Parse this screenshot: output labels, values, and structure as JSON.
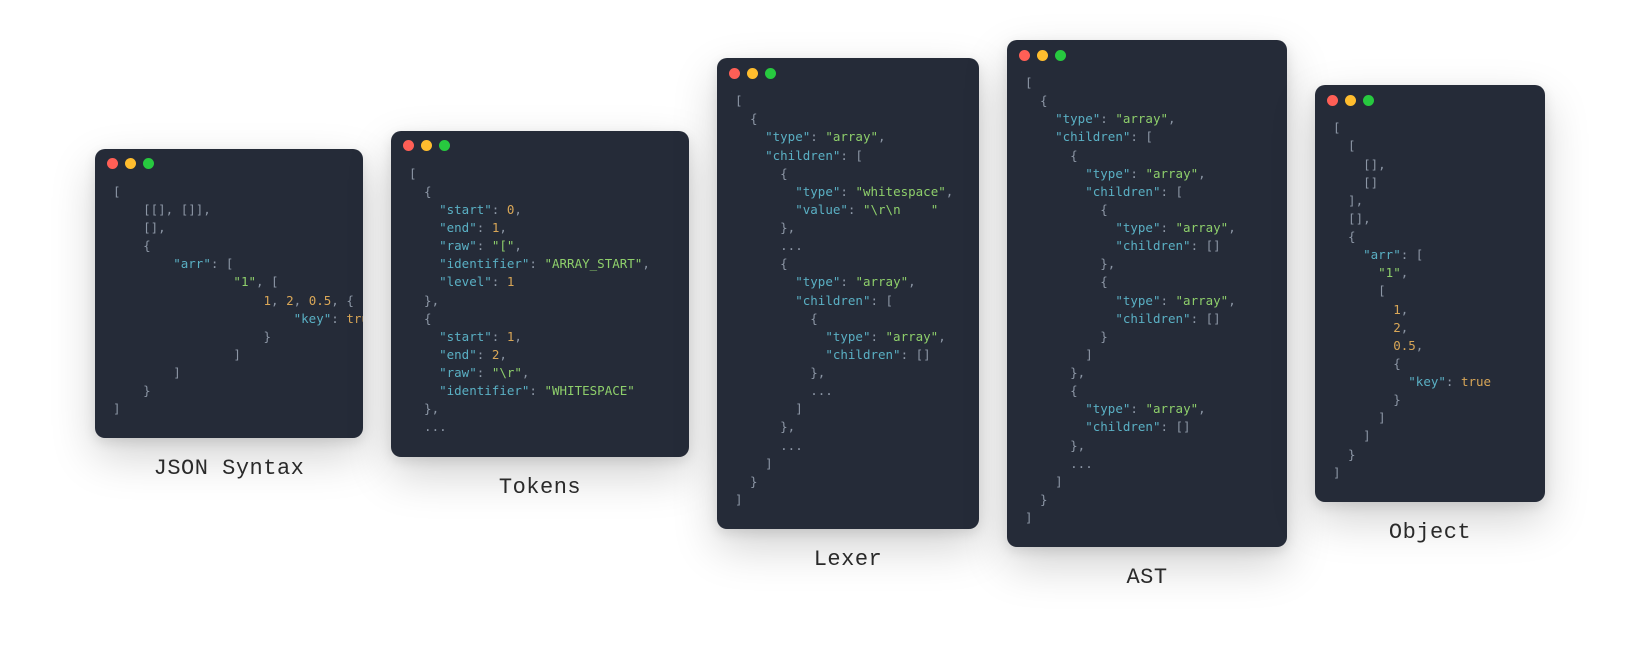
{
  "windows": [
    {
      "label": "JSON Syntax",
      "tokens": [
        {
          "t": "[",
          "c": "p"
        },
        {
          "t": "\n",
          "c": ""
        },
        {
          "t": "    [[], []],",
          "c": "p"
        },
        {
          "t": "\n",
          "c": ""
        },
        {
          "t": "    [],",
          "c": "p"
        },
        {
          "t": "\n",
          "c": ""
        },
        {
          "t": "    {",
          "c": "p"
        },
        {
          "t": "\n",
          "c": ""
        },
        {
          "t": "        ",
          "c": ""
        },
        {
          "t": "\"arr\"",
          "c": "k"
        },
        {
          "t": ": [",
          "c": "p"
        },
        {
          "t": "\n",
          "c": ""
        },
        {
          "t": "                ",
          "c": ""
        },
        {
          "t": "\"1\"",
          "c": "s"
        },
        {
          "t": ", [",
          "c": "p"
        },
        {
          "t": "\n",
          "c": ""
        },
        {
          "t": "                    ",
          "c": ""
        },
        {
          "t": "1",
          "c": "n"
        },
        {
          "t": ", ",
          "c": "p"
        },
        {
          "t": "2",
          "c": "n"
        },
        {
          "t": ", ",
          "c": "p"
        },
        {
          "t": "0.5",
          "c": "n"
        },
        {
          "t": ", {",
          "c": "p"
        },
        {
          "t": "\n",
          "c": ""
        },
        {
          "t": "                        ",
          "c": ""
        },
        {
          "t": "\"key\"",
          "c": "k"
        },
        {
          "t": ": ",
          "c": "p"
        },
        {
          "t": "true",
          "c": "n"
        },
        {
          "t": "\n",
          "c": ""
        },
        {
          "t": "                    }",
          "c": "p"
        },
        {
          "t": "\n",
          "c": ""
        },
        {
          "t": "                ]",
          "c": "p"
        },
        {
          "t": "\n",
          "c": ""
        },
        {
          "t": "        ]",
          "c": "p"
        },
        {
          "t": "\n",
          "c": ""
        },
        {
          "t": "    }",
          "c": "p"
        },
        {
          "t": "\n",
          "c": ""
        },
        {
          "t": "]",
          "c": "p"
        }
      ]
    },
    {
      "label": "Tokens",
      "tokens": [
        {
          "t": "[",
          "c": "p"
        },
        {
          "t": "\n",
          "c": ""
        },
        {
          "t": "  {",
          "c": "p"
        },
        {
          "t": "\n",
          "c": ""
        },
        {
          "t": "    ",
          "c": ""
        },
        {
          "t": "\"start\"",
          "c": "k"
        },
        {
          "t": ": ",
          "c": "p"
        },
        {
          "t": "0",
          "c": "n"
        },
        {
          "t": ",",
          "c": "p"
        },
        {
          "t": "\n",
          "c": ""
        },
        {
          "t": "    ",
          "c": ""
        },
        {
          "t": "\"end\"",
          "c": "k"
        },
        {
          "t": ": ",
          "c": "p"
        },
        {
          "t": "1",
          "c": "n"
        },
        {
          "t": ",",
          "c": "p"
        },
        {
          "t": "\n",
          "c": ""
        },
        {
          "t": "    ",
          "c": ""
        },
        {
          "t": "\"raw\"",
          "c": "k"
        },
        {
          "t": ": ",
          "c": "p"
        },
        {
          "t": "\"[\"",
          "c": "s"
        },
        {
          "t": ",",
          "c": "p"
        },
        {
          "t": "\n",
          "c": ""
        },
        {
          "t": "    ",
          "c": ""
        },
        {
          "t": "\"identifier\"",
          "c": "k"
        },
        {
          "t": ": ",
          "c": "p"
        },
        {
          "t": "\"ARRAY_START\"",
          "c": "s"
        },
        {
          "t": ",",
          "c": "p"
        },
        {
          "t": "\n",
          "c": ""
        },
        {
          "t": "    ",
          "c": ""
        },
        {
          "t": "\"level\"",
          "c": "k"
        },
        {
          "t": ": ",
          "c": "p"
        },
        {
          "t": "1",
          "c": "n"
        },
        {
          "t": "\n",
          "c": ""
        },
        {
          "t": "  },",
          "c": "p"
        },
        {
          "t": "\n",
          "c": ""
        },
        {
          "t": "  {",
          "c": "p"
        },
        {
          "t": "\n",
          "c": ""
        },
        {
          "t": "    ",
          "c": ""
        },
        {
          "t": "\"start\"",
          "c": "k"
        },
        {
          "t": ": ",
          "c": "p"
        },
        {
          "t": "1",
          "c": "n"
        },
        {
          "t": ",",
          "c": "p"
        },
        {
          "t": "\n",
          "c": ""
        },
        {
          "t": "    ",
          "c": ""
        },
        {
          "t": "\"end\"",
          "c": "k"
        },
        {
          "t": ": ",
          "c": "p"
        },
        {
          "t": "2",
          "c": "n"
        },
        {
          "t": ",",
          "c": "p"
        },
        {
          "t": "\n",
          "c": ""
        },
        {
          "t": "    ",
          "c": ""
        },
        {
          "t": "\"raw\"",
          "c": "k"
        },
        {
          "t": ": ",
          "c": "p"
        },
        {
          "t": "\"\\r\"",
          "c": "s"
        },
        {
          "t": ",",
          "c": "p"
        },
        {
          "t": "\n",
          "c": ""
        },
        {
          "t": "    ",
          "c": ""
        },
        {
          "t": "\"identifier\"",
          "c": "k"
        },
        {
          "t": ": ",
          "c": "p"
        },
        {
          "t": "\"WHITESPACE\"",
          "c": "s"
        },
        {
          "t": "\n",
          "c": ""
        },
        {
          "t": "  },",
          "c": "p"
        },
        {
          "t": "\n",
          "c": ""
        },
        {
          "t": "  ...",
          "c": "p"
        }
      ]
    },
    {
      "label": "Lexer",
      "tokens": [
        {
          "t": "[",
          "c": "p"
        },
        {
          "t": "\n",
          "c": ""
        },
        {
          "t": "  {",
          "c": "p"
        },
        {
          "t": "\n",
          "c": ""
        },
        {
          "t": "    ",
          "c": ""
        },
        {
          "t": "\"type\"",
          "c": "k"
        },
        {
          "t": ": ",
          "c": "p"
        },
        {
          "t": "\"array\"",
          "c": "s"
        },
        {
          "t": ",",
          "c": "p"
        },
        {
          "t": "\n",
          "c": ""
        },
        {
          "t": "    ",
          "c": ""
        },
        {
          "t": "\"children\"",
          "c": "k"
        },
        {
          "t": ": [",
          "c": "p"
        },
        {
          "t": "\n",
          "c": ""
        },
        {
          "t": "      {",
          "c": "p"
        },
        {
          "t": "\n",
          "c": ""
        },
        {
          "t": "        ",
          "c": ""
        },
        {
          "t": "\"type\"",
          "c": "k"
        },
        {
          "t": ": ",
          "c": "p"
        },
        {
          "t": "\"whitespace\"",
          "c": "s"
        },
        {
          "t": ",",
          "c": "p"
        },
        {
          "t": "\n",
          "c": ""
        },
        {
          "t": "        ",
          "c": ""
        },
        {
          "t": "\"value\"",
          "c": "k"
        },
        {
          "t": ": ",
          "c": "p"
        },
        {
          "t": "\"\\r\\n    \"",
          "c": "s"
        },
        {
          "t": "\n",
          "c": ""
        },
        {
          "t": "      },",
          "c": "p"
        },
        {
          "t": "\n",
          "c": ""
        },
        {
          "t": "      ...",
          "c": "p"
        },
        {
          "t": "\n",
          "c": ""
        },
        {
          "t": "      {",
          "c": "p"
        },
        {
          "t": "\n",
          "c": ""
        },
        {
          "t": "        ",
          "c": ""
        },
        {
          "t": "\"type\"",
          "c": "k"
        },
        {
          "t": ": ",
          "c": "p"
        },
        {
          "t": "\"array\"",
          "c": "s"
        },
        {
          "t": ",",
          "c": "p"
        },
        {
          "t": "\n",
          "c": ""
        },
        {
          "t": "        ",
          "c": ""
        },
        {
          "t": "\"children\"",
          "c": "k"
        },
        {
          "t": ": [",
          "c": "p"
        },
        {
          "t": "\n",
          "c": ""
        },
        {
          "t": "          {",
          "c": "p"
        },
        {
          "t": "\n",
          "c": ""
        },
        {
          "t": "            ",
          "c": ""
        },
        {
          "t": "\"type\"",
          "c": "k"
        },
        {
          "t": ": ",
          "c": "p"
        },
        {
          "t": "\"array\"",
          "c": "s"
        },
        {
          "t": ",",
          "c": "p"
        },
        {
          "t": "\n",
          "c": ""
        },
        {
          "t": "            ",
          "c": ""
        },
        {
          "t": "\"children\"",
          "c": "k"
        },
        {
          "t": ": []",
          "c": "p"
        },
        {
          "t": "\n",
          "c": ""
        },
        {
          "t": "          },",
          "c": "p"
        },
        {
          "t": "\n",
          "c": ""
        },
        {
          "t": "          ...",
          "c": "p"
        },
        {
          "t": "\n",
          "c": ""
        },
        {
          "t": "        ]",
          "c": "p"
        },
        {
          "t": "\n",
          "c": ""
        },
        {
          "t": "      },",
          "c": "p"
        },
        {
          "t": "\n",
          "c": ""
        },
        {
          "t": "      ...",
          "c": "p"
        },
        {
          "t": "\n",
          "c": ""
        },
        {
          "t": "    ]",
          "c": "p"
        },
        {
          "t": "\n",
          "c": ""
        },
        {
          "t": "  }",
          "c": "p"
        },
        {
          "t": "\n",
          "c": ""
        },
        {
          "t": "]",
          "c": "p"
        }
      ]
    },
    {
      "label": "AST",
      "tokens": [
        {
          "t": "[",
          "c": "p"
        },
        {
          "t": "\n",
          "c": ""
        },
        {
          "t": "  {",
          "c": "p"
        },
        {
          "t": "\n",
          "c": ""
        },
        {
          "t": "    ",
          "c": ""
        },
        {
          "t": "\"type\"",
          "c": "k"
        },
        {
          "t": ": ",
          "c": "p"
        },
        {
          "t": "\"array\"",
          "c": "s"
        },
        {
          "t": ",",
          "c": "p"
        },
        {
          "t": "\n",
          "c": ""
        },
        {
          "t": "    ",
          "c": ""
        },
        {
          "t": "\"children\"",
          "c": "k"
        },
        {
          "t": ": [",
          "c": "p"
        },
        {
          "t": "\n",
          "c": ""
        },
        {
          "t": "      {",
          "c": "p"
        },
        {
          "t": "\n",
          "c": ""
        },
        {
          "t": "        ",
          "c": ""
        },
        {
          "t": "\"type\"",
          "c": "k"
        },
        {
          "t": ": ",
          "c": "p"
        },
        {
          "t": "\"array\"",
          "c": "s"
        },
        {
          "t": ",",
          "c": "p"
        },
        {
          "t": "\n",
          "c": ""
        },
        {
          "t": "        ",
          "c": ""
        },
        {
          "t": "\"children\"",
          "c": "k"
        },
        {
          "t": ": [",
          "c": "p"
        },
        {
          "t": "\n",
          "c": ""
        },
        {
          "t": "          {",
          "c": "p"
        },
        {
          "t": "\n",
          "c": ""
        },
        {
          "t": "            ",
          "c": ""
        },
        {
          "t": "\"type\"",
          "c": "k"
        },
        {
          "t": ": ",
          "c": "p"
        },
        {
          "t": "\"array\"",
          "c": "s"
        },
        {
          "t": ",",
          "c": "p"
        },
        {
          "t": "\n",
          "c": ""
        },
        {
          "t": "            ",
          "c": ""
        },
        {
          "t": "\"children\"",
          "c": "k"
        },
        {
          "t": ": []",
          "c": "p"
        },
        {
          "t": "\n",
          "c": ""
        },
        {
          "t": "          },",
          "c": "p"
        },
        {
          "t": "\n",
          "c": ""
        },
        {
          "t": "          {",
          "c": "p"
        },
        {
          "t": "\n",
          "c": ""
        },
        {
          "t": "            ",
          "c": ""
        },
        {
          "t": "\"type\"",
          "c": "k"
        },
        {
          "t": ": ",
          "c": "p"
        },
        {
          "t": "\"array\"",
          "c": "s"
        },
        {
          "t": ",",
          "c": "p"
        },
        {
          "t": "\n",
          "c": ""
        },
        {
          "t": "            ",
          "c": ""
        },
        {
          "t": "\"children\"",
          "c": "k"
        },
        {
          "t": ": []",
          "c": "p"
        },
        {
          "t": "\n",
          "c": ""
        },
        {
          "t": "          }",
          "c": "p"
        },
        {
          "t": "\n",
          "c": ""
        },
        {
          "t": "        ]",
          "c": "p"
        },
        {
          "t": "\n",
          "c": ""
        },
        {
          "t": "      },",
          "c": "p"
        },
        {
          "t": "\n",
          "c": ""
        },
        {
          "t": "      {",
          "c": "p"
        },
        {
          "t": "\n",
          "c": ""
        },
        {
          "t": "        ",
          "c": ""
        },
        {
          "t": "\"type\"",
          "c": "k"
        },
        {
          "t": ": ",
          "c": "p"
        },
        {
          "t": "\"array\"",
          "c": "s"
        },
        {
          "t": ",",
          "c": "p"
        },
        {
          "t": "\n",
          "c": ""
        },
        {
          "t": "        ",
          "c": ""
        },
        {
          "t": "\"children\"",
          "c": "k"
        },
        {
          "t": ": []",
          "c": "p"
        },
        {
          "t": "\n",
          "c": ""
        },
        {
          "t": "      },",
          "c": "p"
        },
        {
          "t": "\n",
          "c": ""
        },
        {
          "t": "      ...",
          "c": "p"
        },
        {
          "t": "\n",
          "c": ""
        },
        {
          "t": "    ]",
          "c": "p"
        },
        {
          "t": "\n",
          "c": ""
        },
        {
          "t": "  }",
          "c": "p"
        },
        {
          "t": "\n",
          "c": ""
        },
        {
          "t": "]",
          "c": "p"
        }
      ]
    },
    {
      "label": "Object",
      "tokens": [
        {
          "t": "[",
          "c": "p"
        },
        {
          "t": "\n",
          "c": ""
        },
        {
          "t": "  [",
          "c": "p"
        },
        {
          "t": "\n",
          "c": ""
        },
        {
          "t": "    [],",
          "c": "p"
        },
        {
          "t": "\n",
          "c": ""
        },
        {
          "t": "    []",
          "c": "p"
        },
        {
          "t": "\n",
          "c": ""
        },
        {
          "t": "  ],",
          "c": "p"
        },
        {
          "t": "\n",
          "c": ""
        },
        {
          "t": "  [],",
          "c": "p"
        },
        {
          "t": "\n",
          "c": ""
        },
        {
          "t": "  {",
          "c": "p"
        },
        {
          "t": "\n",
          "c": ""
        },
        {
          "t": "    ",
          "c": ""
        },
        {
          "t": "\"arr\"",
          "c": "k"
        },
        {
          "t": ": [",
          "c": "p"
        },
        {
          "t": "\n",
          "c": ""
        },
        {
          "t": "      ",
          "c": ""
        },
        {
          "t": "\"1\"",
          "c": "s"
        },
        {
          "t": ",",
          "c": "p"
        },
        {
          "t": "\n",
          "c": ""
        },
        {
          "t": "      [",
          "c": "p"
        },
        {
          "t": "\n",
          "c": ""
        },
        {
          "t": "        ",
          "c": ""
        },
        {
          "t": "1",
          "c": "n"
        },
        {
          "t": ",",
          "c": "p"
        },
        {
          "t": "\n",
          "c": ""
        },
        {
          "t": "        ",
          "c": ""
        },
        {
          "t": "2",
          "c": "n"
        },
        {
          "t": ",",
          "c": "p"
        },
        {
          "t": "\n",
          "c": ""
        },
        {
          "t": "        ",
          "c": ""
        },
        {
          "t": "0.5",
          "c": "n"
        },
        {
          "t": ",",
          "c": "p"
        },
        {
          "t": "\n",
          "c": ""
        },
        {
          "t": "        {",
          "c": "p"
        },
        {
          "t": "\n",
          "c": ""
        },
        {
          "t": "          ",
          "c": ""
        },
        {
          "t": "\"key\"",
          "c": "k"
        },
        {
          "t": ": ",
          "c": "p"
        },
        {
          "t": "true",
          "c": "n"
        },
        {
          "t": "\n",
          "c": ""
        },
        {
          "t": "        }",
          "c": "p"
        },
        {
          "t": "\n",
          "c": ""
        },
        {
          "t": "      ]",
          "c": "p"
        },
        {
          "t": "\n",
          "c": ""
        },
        {
          "t": "    ]",
          "c": "p"
        },
        {
          "t": "\n",
          "c": ""
        },
        {
          "t": "  }",
          "c": "p"
        },
        {
          "t": "\n",
          "c": ""
        },
        {
          "t": "]",
          "c": "p"
        }
      ]
    }
  ]
}
